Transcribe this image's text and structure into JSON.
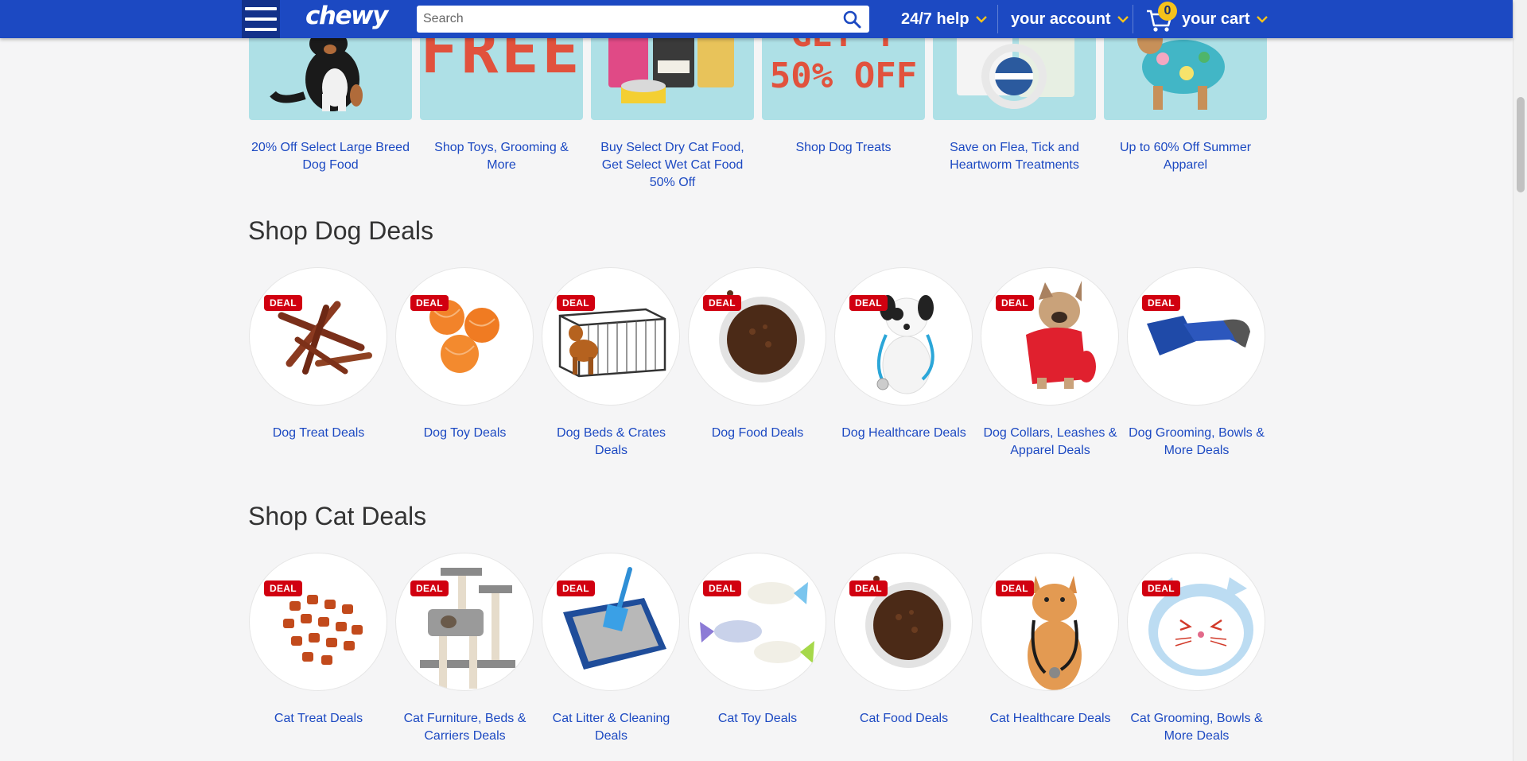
{
  "header": {
    "logo": "chewy",
    "search_placeholder": "Search",
    "help_label": "24/7 help",
    "account_label": "your account",
    "cart_label": "your cart",
    "cart_count": "0"
  },
  "promos": [
    {
      "caption": "20% Off Select Large Breed Dog Food"
    },
    {
      "caption": "Shop Toys, Grooming & More",
      "big_text": "FREE"
    },
    {
      "caption": "Buy Select Dry Cat Food, Get Select Wet Cat Food 50% Off"
    },
    {
      "caption": "Shop Dog Treats",
      "big_text_1": "GET Y",
      "big_text_2": "50% OFF"
    },
    {
      "caption": "Save on Flea, Tick and Heartworm Treatments"
    },
    {
      "caption": "Up to 60% Off Summer Apparel"
    }
  ],
  "dog_section": {
    "title": "Shop Dog Deals",
    "badge": "DEAL",
    "items": [
      {
        "label": "Dog Treat Deals",
        "icon": "bully-sticks"
      },
      {
        "label": "Dog Toy Deals",
        "icon": "tennis-balls"
      },
      {
        "label": "Dog Beds & Crates Deals",
        "icon": "dog-crate"
      },
      {
        "label": "Dog Food Deals",
        "icon": "food-bowl"
      },
      {
        "label": "Dog Healthcare Deals",
        "icon": "puppy-stethoscope"
      },
      {
        "label": "Dog Collars, Leashes & Apparel Deals",
        "icon": "dog-sweater"
      },
      {
        "label": "Dog Grooming, Bowls & More Deals",
        "icon": "grooming-brush"
      }
    ]
  },
  "cat_section": {
    "title": "Shop Cat Deals",
    "badge": "DEAL",
    "items": [
      {
        "label": "Cat Treat Deals",
        "icon": "cat-treats"
      },
      {
        "label": "Cat Furniture, Beds & Carriers Deals",
        "icon": "cat-tree"
      },
      {
        "label": "Cat Litter & Cleaning Deals",
        "icon": "litter-box"
      },
      {
        "label": "Cat Toy Deals",
        "icon": "fish-toys"
      },
      {
        "label": "Cat Food Deals",
        "icon": "food-bowl"
      },
      {
        "label": "Cat Healthcare Deals",
        "icon": "cat-stethoscope"
      },
      {
        "label": "Cat Grooming, Bowls & More Deals",
        "icon": "cat-bowl"
      }
    ]
  },
  "colors": {
    "brand_blue": "#1c49c2",
    "link_blue": "#1c49c2",
    "deal_red": "#d10010",
    "cart_badge": "#f5c21b",
    "promo_bg": "#aee0e6"
  }
}
